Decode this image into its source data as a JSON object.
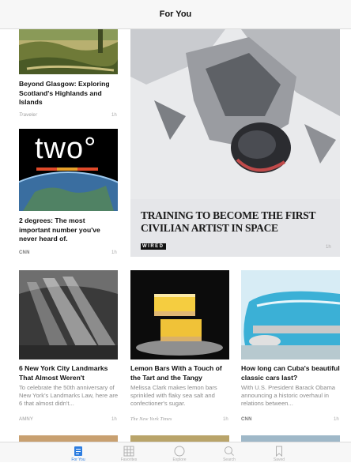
{
  "header": {
    "title": "For You"
  },
  "articles": [
    {
      "title": "Beyond Glasgow: Exploring Scotland's Highlands and Islands",
      "source": "Traveler",
      "time": "1h"
    },
    {
      "title": "2 degrees: The most important number you've never heard of.",
      "source": "CNN",
      "time": "1h",
      "image_text": "two°"
    },
    {
      "title": "TRAINING TO BECOME THE FIRST CIVILIAN ARTIST IN SPACE",
      "source": "WIRED",
      "time": "1h"
    },
    {
      "title": "6 New York City Landmarks That Almost Weren't",
      "excerpt": "To celebrate the 50th anniversary of New York's Landmarks Law, here are 6 that almost didn't...",
      "source": "AMNY",
      "time": "1h"
    },
    {
      "title": "Lemon Bars With a Touch of the Tart and the Tangy",
      "excerpt": "Melissa Clark makes lemon bars sprinkled with flaky sea salt and confectioner's sugar.",
      "source": "The New York Times",
      "time": "1h"
    },
    {
      "title": "How long can Cuba's beautiful classic cars last?",
      "excerpt": "With U.S. President Barack Obama announcing a historic overhaul in relations between...",
      "source": "CNN",
      "time": "1h"
    }
  ],
  "tabbar": {
    "tabs": [
      {
        "label": "For You",
        "icon": "for-you-icon",
        "active": true
      },
      {
        "label": "Favorites",
        "icon": "favorites-grid-icon",
        "active": false
      },
      {
        "label": "Explore",
        "icon": "compass-icon",
        "active": false
      },
      {
        "label": "Search",
        "icon": "search-icon",
        "active": false
      },
      {
        "label": "Saved",
        "icon": "bookmark-icon",
        "active": false
      }
    ]
  },
  "colors": {
    "accent": "#2d7de0",
    "header_bg": "#f7f7f7",
    "muted_text": "#8a8a8a"
  }
}
